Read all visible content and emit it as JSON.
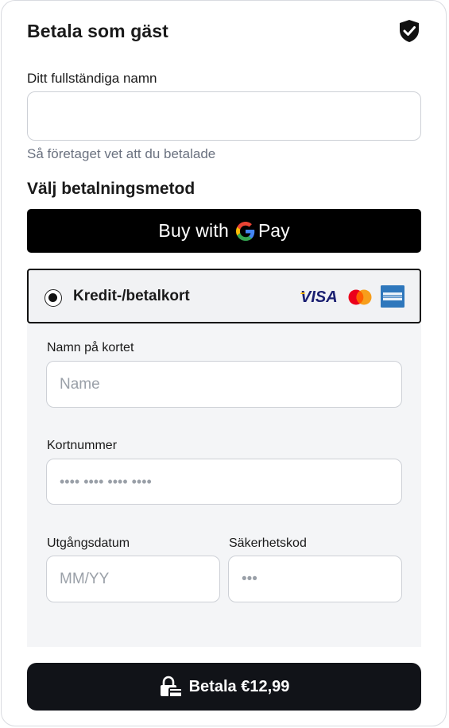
{
  "header": {
    "title": "Betala som gäst",
    "security_icon": "shield-check-icon"
  },
  "guest": {
    "name_label": "Ditt fullständiga namn",
    "name_value": "",
    "name_hint": "Så företaget vet att du betalade"
  },
  "payment_method": {
    "title": "Välj betalningsmetod",
    "gpay_prefix": "Buy with",
    "gpay_suffix": "Pay",
    "card_option_label": "Kredit-/betalkort",
    "card_option_selected": true,
    "brands": [
      "VISA",
      "mastercard-icon",
      "amex-icon"
    ]
  },
  "card_form": {
    "name_label": "Namn på kortet",
    "name_placeholder": "Name",
    "number_label": "Kortnummer",
    "number_placeholder": "•••• •••• •••• ••••",
    "expiry_label": "Utgångsdatum",
    "expiry_placeholder": "MM/YY",
    "cvc_label": "Säkerhetskod",
    "cvc_placeholder": "•••"
  },
  "pay_button": {
    "label": "Betala €12,99",
    "icon": "lock-card-icon"
  },
  "colors": {
    "primary_button": "#111318",
    "gpay_bg": "#000000",
    "hint_text": "#6b7280",
    "form_bg": "#f4f5f7",
    "visa_blue": "#1a1f71",
    "visa_gold": "#f7b600",
    "amex_blue": "#2e77bc"
  }
}
